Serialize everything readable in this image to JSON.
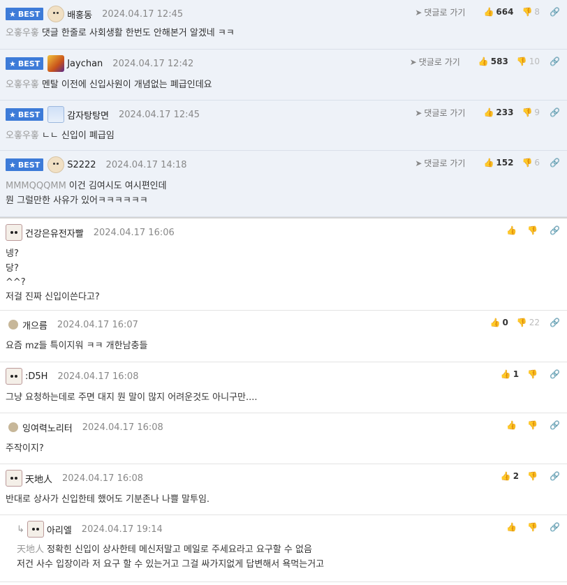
{
  "best_label": "BEST",
  "goto_label": "댓글로 가기",
  "comments": [
    {
      "best": true,
      "avatar": "dog-icon",
      "nick": "배홍동",
      "date": "2024.04.17 12:45",
      "reply_to": "오홓우홓",
      "text": [
        "댓글 한줄로 사회생활 한번도 안해본거 알겠네 ㅋㅋ"
      ],
      "up": "664",
      "down": "8"
    },
    {
      "best": true,
      "avatar": "flame-avatar-icon",
      "nick": "Jaychan",
      "date": "2024.04.17 12:42",
      "reply_to": "오홓우홓",
      "text": [
        "멘탈 이전에 신입사원이 개념없는 폐급인데요"
      ],
      "up": "583",
      "down": "10"
    },
    {
      "best": true,
      "avatar": "blue-avatar-icon",
      "nick": "감자탕탕면",
      "date": "2024.04.17 12:45",
      "reply_to": "오홓우홓",
      "text": [
        "ㄴㄴ 신입이 폐급임"
      ],
      "up": "233",
      "down": "9"
    },
    {
      "best": true,
      "avatar": "dog-icon",
      "nick": "S2222",
      "date": "2024.04.17 14:18",
      "reply_to": "MMMQQQMM",
      "text": [
        "이건 김여시도 여시편인데",
        "뭔 그럴만한 사유가 있어ㅋㅋㅋㅋㅋㅋ"
      ],
      "up": "152",
      "down": "6"
    },
    {
      "best": false,
      "avatar": "puppy-avatar-icon",
      "nick": "건강은유전자빨",
      "date": "2024.04.17 16:06",
      "text": [
        "넹?",
        "당?",
        "^^?",
        "저걸 진짜 신입이쓴다고?"
      ],
      "up": "",
      "down": ""
    },
    {
      "best": false,
      "avatar": "dot-avatar-icon",
      "nick": "개으름",
      "date": "2024.04.17 16:07",
      "text": [
        "요즘 mz들 특이지워 ㅋㅋ 개한남충들"
      ],
      "up": "0",
      "down": "22"
    },
    {
      "best": false,
      "avatar": "puppy-avatar-icon",
      "nick": ":D5H",
      "date": "2024.04.17 16:08",
      "text": [
        "그냥 요청하는데로 주면 대지 뭔 말이 많지 어려운것도 아니구만...."
      ],
      "up": "1",
      "down": ""
    },
    {
      "best": false,
      "avatar": "dot-avatar-icon",
      "nick": "잉여력노리터",
      "date": "2024.04.17 16:08",
      "text": [
        "주작이지?"
      ],
      "up": "",
      "down": ""
    },
    {
      "best": false,
      "avatar": "puppy-avatar-icon",
      "nick": "天地人",
      "date": "2024.04.17 16:08",
      "text": [
        "반대로 상사가 신입한테 했어도 기분존나 나쁠 말투임."
      ],
      "up": "2",
      "down": ""
    },
    {
      "best": false,
      "reply": true,
      "avatar": "puppy-avatar-icon",
      "nick": "아리엘",
      "date": "2024.04.17 19:14",
      "reply_to": "天地人",
      "text": [
        "정확힌 신입이 상사한테 메신저말고 메일로 주세요라고 요구할 수 없음",
        "저건 사수 입장이라 저 요구 할 수 있는거고 그걸 싸가지없게 답변해서 욕먹는거고"
      ],
      "up": "",
      "down": ""
    }
  ]
}
